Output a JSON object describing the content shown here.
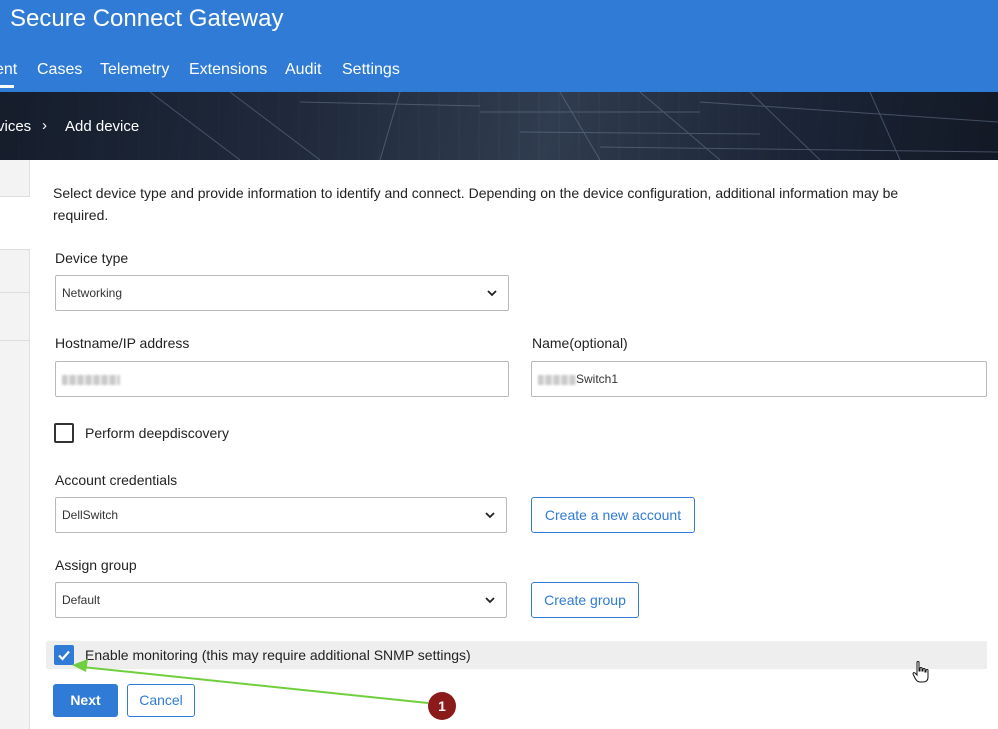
{
  "app": {
    "title": "Secure Connect Gateway"
  },
  "nav": {
    "items": [
      {
        "label": "ent",
        "active": true
      },
      {
        "label": "Cases"
      },
      {
        "label": "Telemetry"
      },
      {
        "label": "Extensions"
      },
      {
        "label": "Audit"
      },
      {
        "label": "Settings"
      }
    ]
  },
  "breadcrumb": {
    "parent": "vices",
    "separator": "›",
    "current": "Add device"
  },
  "form": {
    "intro": "Select device type and provide information to identify and connect. Depending on the device configuration, additional information may be required.",
    "device_type": {
      "label": "Device type",
      "value": "Networking"
    },
    "hostname": {
      "label": "Hostname/IP address",
      "value": ""
    },
    "name": {
      "label": "Name(optional)",
      "value": "Switch1"
    },
    "deepdiscovery": {
      "label": "Perform deepdiscovery",
      "checked": false
    },
    "account_credentials": {
      "label": "Account credentials",
      "value": "DellSwitch",
      "create_label": "Create a new account"
    },
    "assign_group": {
      "label": "Assign group",
      "value": "Default",
      "create_label": "Create group"
    },
    "monitoring": {
      "label": "Enable monitoring (this may require additional SNMP settings)",
      "checked": true
    },
    "next_label": "Next",
    "cancel_label": "Cancel"
  },
  "annotation": {
    "badge": "1"
  },
  "colors": {
    "primary": "#2f7bd6",
    "badge": "#8b1a1a",
    "arrow": "#6fcf3f"
  }
}
